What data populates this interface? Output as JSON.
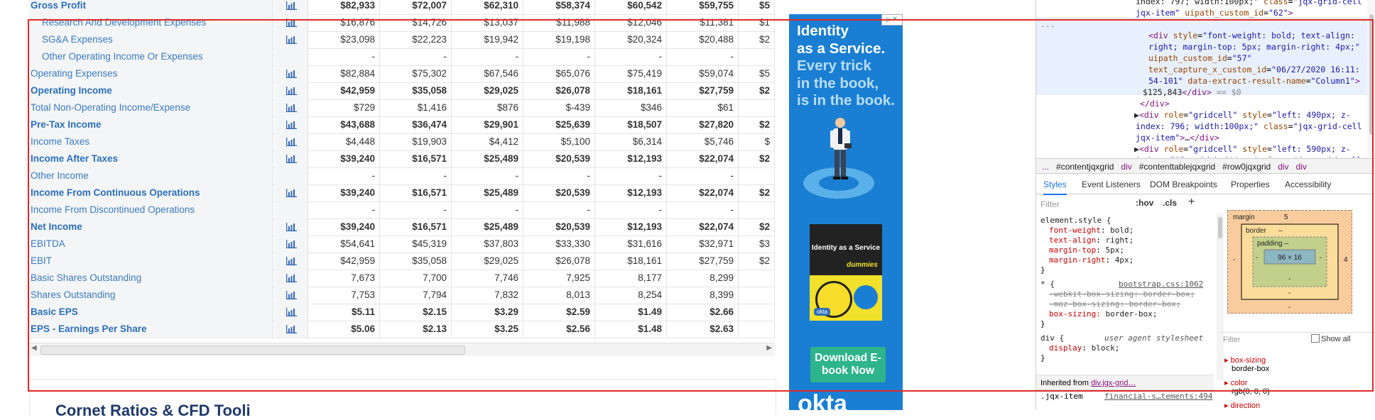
{
  "grid": {
    "rows": [
      {
        "label": "Gross Profit",
        "sub": false,
        "bold": true,
        "chart": true,
        "values": [
          "$82,933",
          "$72,007",
          "$62,310",
          "$58,374",
          "$60,542",
          "$59,755",
          "$5"
        ]
      },
      {
        "label": "Research And Development Expenses",
        "sub": true,
        "bold": false,
        "chart": true,
        "values": [
          "$16,876",
          "$14,726",
          "$13,037",
          "$11,988",
          "$12,046",
          "$11,381",
          "$1"
        ]
      },
      {
        "label": "SG&A Expenses",
        "sub": true,
        "bold": false,
        "chart": true,
        "values": [
          "$23,098",
          "$22,223",
          "$19,942",
          "$19,198",
          "$20,324",
          "$20,488",
          "$2"
        ]
      },
      {
        "label": "Other Operating Income Or Expenses",
        "sub": true,
        "bold": false,
        "chart": false,
        "values": [
          "-",
          "-",
          "-",
          "-",
          "-",
          "-",
          ""
        ]
      },
      {
        "label": "Operating Expenses",
        "sub": false,
        "bold": false,
        "chart": true,
        "values": [
          "$82,884",
          "$75,302",
          "$67,546",
          "$65,076",
          "$75,419",
          "$59,074",
          "$5"
        ]
      },
      {
        "label": "Operating Income",
        "sub": false,
        "bold": true,
        "chart": true,
        "values": [
          "$42,959",
          "$35,058",
          "$29,025",
          "$26,078",
          "$18,161",
          "$27,759",
          "$2"
        ]
      },
      {
        "label": "Total Non-Operating Income/Expense",
        "sub": false,
        "bold": false,
        "chart": true,
        "values": [
          "$729",
          "$1,416",
          "$876",
          "$-439",
          "$346",
          "$61",
          ""
        ]
      },
      {
        "label": "Pre-Tax Income",
        "sub": false,
        "bold": true,
        "chart": true,
        "values": [
          "$43,688",
          "$36,474",
          "$29,901",
          "$25,639",
          "$18,507",
          "$27,820",
          "$2"
        ]
      },
      {
        "label": "Income Taxes",
        "sub": false,
        "bold": false,
        "chart": true,
        "values": [
          "$4,448",
          "$19,903",
          "$4,412",
          "$5,100",
          "$6,314",
          "$5,746",
          "$"
        ]
      },
      {
        "label": "Income After Taxes",
        "sub": false,
        "bold": true,
        "chart": true,
        "values": [
          "$39,240",
          "$16,571",
          "$25,489",
          "$20,539",
          "$12,193",
          "$22,074",
          "$2"
        ]
      },
      {
        "label": "Other Income",
        "sub": false,
        "bold": false,
        "chart": false,
        "values": [
          "-",
          "-",
          "-",
          "-",
          "-",
          "-",
          ""
        ]
      },
      {
        "label": "Income From Continuous Operations",
        "sub": false,
        "bold": true,
        "chart": true,
        "values": [
          "$39,240",
          "$16,571",
          "$25,489",
          "$20,539",
          "$12,193",
          "$22,074",
          "$2"
        ]
      },
      {
        "label": "Income From Discontinued Operations",
        "sub": false,
        "bold": false,
        "chart": false,
        "values": [
          "-",
          "-",
          "-",
          "-",
          "-",
          "-",
          ""
        ]
      },
      {
        "label": "Net Income",
        "sub": false,
        "bold": true,
        "chart": true,
        "values": [
          "$39,240",
          "$16,571",
          "$25,489",
          "$20,539",
          "$12,193",
          "$22,074",
          "$2"
        ]
      },
      {
        "label": "EBITDA",
        "sub": false,
        "bold": false,
        "chart": true,
        "values": [
          "$54,641",
          "$45,319",
          "$37,803",
          "$33,330",
          "$31,616",
          "$32,971",
          "$3"
        ]
      },
      {
        "label": "EBIT",
        "sub": false,
        "bold": false,
        "chart": true,
        "values": [
          "$42,959",
          "$35,058",
          "$29,025",
          "$26,078",
          "$18,161",
          "$27,759",
          "$2"
        ]
      },
      {
        "label": "Basic Shares Outstanding",
        "sub": false,
        "bold": false,
        "chart": true,
        "values": [
          "7,673",
          "7,700",
          "7,746",
          "7,925",
          "8,177",
          "8,299",
          ""
        ]
      },
      {
        "label": "Shares Outstanding",
        "sub": false,
        "bold": false,
        "chart": true,
        "values": [
          "7,753",
          "7,794",
          "7,832",
          "8,013",
          "8,254",
          "8,399",
          ""
        ]
      },
      {
        "label": "Basic EPS",
        "sub": false,
        "bold": true,
        "chart": true,
        "values": [
          "$5.11",
          "$2.15",
          "$3.29",
          "$2.59",
          "$1.49",
          "$2.66",
          ""
        ]
      },
      {
        "label": "EPS - Earnings Per Share",
        "sub": false,
        "bold": true,
        "chart": true,
        "values": [
          "$5.06",
          "$2.13",
          "$3.25",
          "$2.56",
          "$1.48",
          "$2.63",
          ""
        ]
      }
    ]
  },
  "below": {
    "heading": "Cornet Ratios & CFD Tooli"
  },
  "ad": {
    "headline_1": "Identity",
    "headline_2": "as a Service.",
    "headline_3": "Every trick",
    "headline_4": "in the book,",
    "headline_5": "is in the book.",
    "book_title": "Identity as a Service",
    "book_brand": "dummies",
    "book_okta": "okta",
    "cta": "Download E-book Now",
    "logo": "okta",
    "adchoice": "▷✕"
  },
  "devtools": {
    "dom_lines": [
      {
        "html": "<span class='txt'>index: 797; width:100px;\" </span><span class='att'>class</span>=<span class='val'>\"jqx-grid-cell</span>"
      },
      {
        "html": "<span class='val'>jqx-item\"</span> <span class='att'>uipath_custom_id</span>=<span class='val'>\"62\"</span><span class='tag'>&gt;</span>"
      },
      {
        "html": "<span class='cmt'>...</span>"
      },
      {
        "html": "<span class='tag'>&lt;div</span> <span class='att'>style</span>=<span class='val'>\"font-weight: bold; text-align:</span>"
      },
      {
        "html": "<span class='val'>right; margin-top: 5px; margin-right: 4px;\"</span>"
      },
      {
        "html": "<span class='att'>uipath_custom_id</span>=<span class='val'>\"57\"</span>"
      },
      {
        "html": "<span class='att'>text_capture_x_custom_id</span>=<span class='val'>\"06/27/2020 16:11:</span>"
      },
      {
        "html": "<span class='val'>54-101\"</span> <span class='att'>data-extract-result-name</span>=<span class='val'>\"Column1\"</span><span class='tag'>&gt;</span>"
      },
      {
        "html": "<span class='txt'>$125,843</span><span class='tag'>&lt;/div&gt;</span> <span class='cmt'>== $0</span>"
      },
      {
        "html": "<span class='tag'>&lt;/div&gt;</span>"
      },
      {
        "html": "<span class='txt'>▶</span><span class='tag'>&lt;div</span> <span class='att'>role</span>=<span class='val'>\"gridcell\"</span> <span class='att'>style</span>=<span class='val'>\"left: 490px; z-</span>"
      },
      {
        "html": "<span class='val'>index: 796; width:100px;\"</span> <span class='att'>class</span>=<span class='val'>\"jqx-grid-cell</span>"
      },
      {
        "html": "<span class='val'>jqx-item\"</span><span class='tag'>&gt;</span><span class='txt'>…</span><span class='tag'>&lt;/div&gt;</span>"
      },
      {
        "html": "<span class='txt'>▶</span><span class='tag'>&lt;div</span> <span class='att'>role</span>=<span class='val'>\"gridcell\"</span> <span class='att'>style</span>=<span class='val'>\"left: 590px; z-</span>"
      },
      {
        "html": "<span class='val'>index: 795; width:100px;\"</span> <span class='att'>class</span>=<span class='val'>\"jqx-grid-cell</span>"
      }
    ],
    "breadcrumbs": [
      "...",
      "#contentjqxgrid",
      "div",
      "#contenttablejqxgrid",
      "#row0jqxgrid",
      "div",
      "div"
    ],
    "tabs": [
      "Styles",
      "Event Listeners",
      "DOM Breakpoints",
      "Properties",
      "Accessibility"
    ],
    "filter_placeholder": "Filter",
    "hov": ":hov",
    "cls": ".cls",
    "plus": "+",
    "element_style_selector": "element.style {",
    "element_style_props": [
      {
        "p": "font-weight",
        "v": "bold;"
      },
      {
        "p": "text-align",
        "v": "right;"
      },
      {
        "p": "margin-top",
        "v": "5px;"
      },
      {
        "p": "margin-right",
        "v": "4px;"
      }
    ],
    "close_brace": "}",
    "rule2_selector": "* {",
    "rule2_source": "bootstrap.css:1062",
    "rule2_props": [
      {
        "p": "-webkit-box-sizing",
        "v": "border-box;",
        "strike": true
      },
      {
        "p": "-moz-box-sizing",
        "v": "border-box;",
        "strike": true
      },
      {
        "p": "box-sizing",
        "v": "border-box;",
        "strike": false
      }
    ],
    "rule3_selector": "div {",
    "rule3_source": "user agent stylesheet",
    "rule3_prop": "display",
    "rule3_val": "block;",
    "inherited_label": "Inherited from",
    "inherited_sel": "div.jqx-grid…",
    "bottom_sel": ".jqx-item",
    "bottom_source": "financial-s…tements:494",
    "box": {
      "margin_label": "margin",
      "margin_top": "5",
      "margin_right": "4",
      "margin_bottom": "-",
      "margin_left": "-",
      "border_label": "border",
      "border_val": "–",
      "padding_label": "padding –",
      "content": "96 × 16",
      "dash": "-"
    },
    "computed_filter": "Filter",
    "show_all": "Show all",
    "computed": [
      {
        "p": "box-sizing",
        "v": "border-box"
      },
      {
        "p": "color",
        "v": "rgb(0, 0, 0)"
      },
      {
        "p": "direction",
        "v": ""
      }
    ]
  }
}
